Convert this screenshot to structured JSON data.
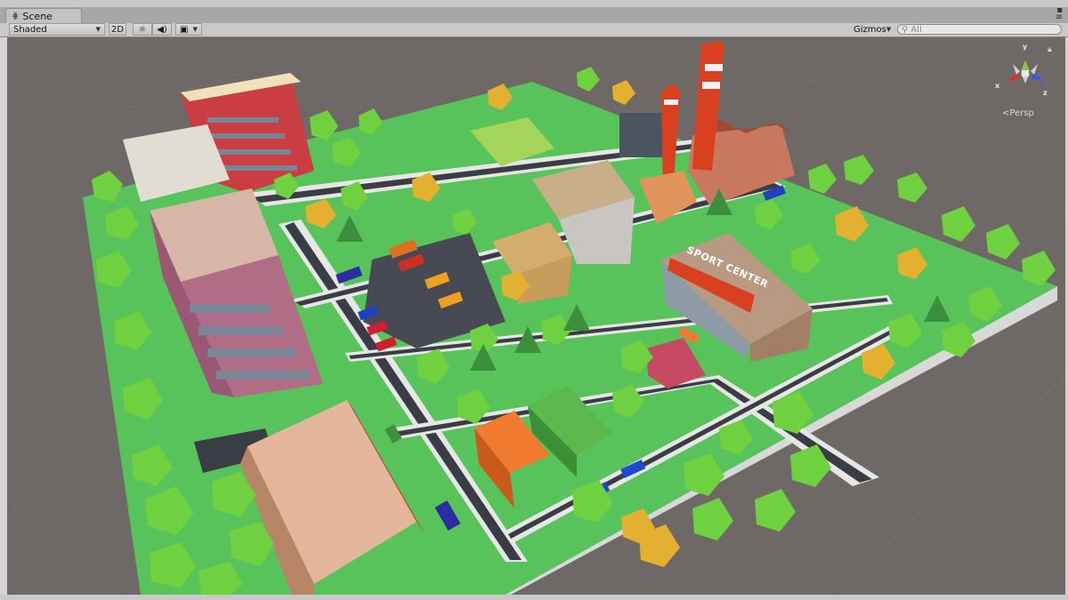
{
  "window": {
    "tab_title": "Scene",
    "tab_icon": "scene-grid-icon"
  },
  "toolbar": {
    "shading_mode": "Shaded",
    "mode_2d": "2D",
    "lighting_icon": "sun-icon",
    "audio_icon": "speaker-icon",
    "effects_icon": "image-effects-icon",
    "gizmos_label": "Gizmos",
    "search_placeholder": "All"
  },
  "viewport": {
    "projection_label": "Persp",
    "axis_labels": {
      "x": "x",
      "y": "y",
      "z": "z"
    }
  },
  "scene_text": {
    "sport_center_sign": "SPORT CENTER"
  },
  "colors": {
    "viewport_bg": "#6e6966",
    "grass": "#58c35a",
    "road": "#3a3d44",
    "sidewalk": "#e8e8e8",
    "tree_green": "#6fd13f",
    "tree_orange": "#e3b12f",
    "chimney_red": "#d9401f"
  }
}
